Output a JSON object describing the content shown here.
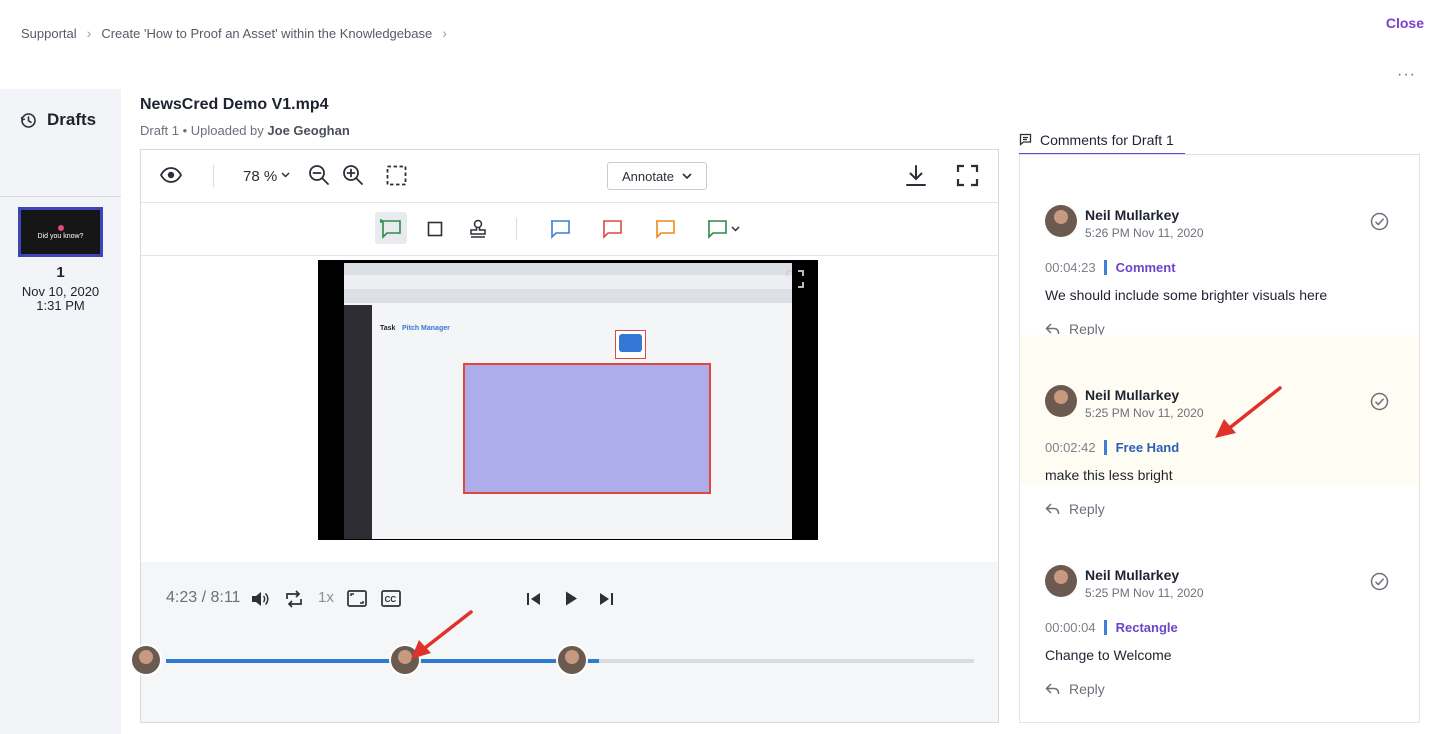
{
  "breadcrumb": {
    "items": [
      "Supportal",
      "Create 'How to Proof an Asset' within the Knowledgebase"
    ]
  },
  "close_label": "Close",
  "drafts": {
    "title": "Drafts",
    "thumbnail_text": "Did you know?",
    "items": [
      {
        "number": "1",
        "date": "Nov 10, 2020",
        "time": "1:31 PM"
      }
    ]
  },
  "file": {
    "title": "NewsCred Demo V1.mp4",
    "draft_label": "Draft 1 • Uploaded by",
    "uploader": "Joe Geoghan"
  },
  "toolbar": {
    "zoom": "78 %",
    "annotate_label": "Annotate"
  },
  "video_text": {
    "tab_task": "Task",
    "tab_pitch": "Pitch Manager"
  },
  "player": {
    "current_time": "4:23",
    "separator": "/",
    "duration": "8:11",
    "speed": "1x",
    "progress": 0.536
  },
  "comments_panel": {
    "tab_label": "Comments for Draft 1",
    "comments": [
      {
        "author": "Neil Mullarkey",
        "time": "5:26 PM Nov 11, 2020",
        "timestamp": "00:04:23",
        "type": "Comment",
        "text": "We should include some brighter visuals here",
        "reply_label": "Reply"
      },
      {
        "author": "Neil Mullarkey",
        "time": "5:25 PM Nov 11, 2020",
        "timestamp": "00:02:42",
        "type": "Free Hand",
        "text": "make this less bright",
        "reply_label": "Reply"
      },
      {
        "author": "Neil Mullarkey",
        "time": "5:25 PM Nov 11, 2020",
        "timestamp": "00:00:04",
        "type": "Rectangle",
        "text": "Change to Welcome",
        "reply_label": "Reply"
      }
    ]
  },
  "colors": {
    "accent_purple": "#6a45c9",
    "progress_blue": "#2f7bd0",
    "annotation_red": "#e0483e"
  }
}
